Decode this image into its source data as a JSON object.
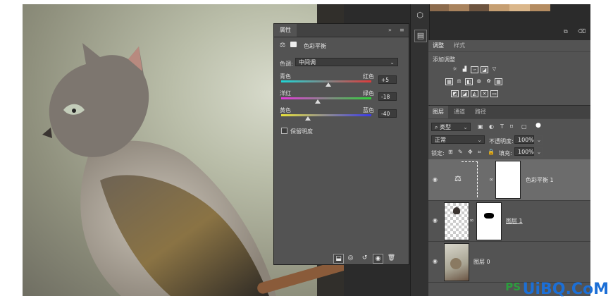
{
  "properties_panel": {
    "tab_label": "属性",
    "collapse_label": "»",
    "menu_label": "≡",
    "adjustment_name": "色彩平衡",
    "tone_label": "色调:",
    "tone_value": "中间调",
    "sliders": [
      {
        "left": "青色",
        "right": "红色",
        "value": "+5",
        "level": 0.525
      },
      {
        "left": "洋红",
        "right": "绿色",
        "value": "-18",
        "level": 0.41
      },
      {
        "left": "黄色",
        "right": "蓝色",
        "value": "-40",
        "level": 0.3
      }
    ],
    "preserve_luminosity_label": "保留明度"
  },
  "adjustments_panel": {
    "tab_adjust": "调整",
    "tab_styles": "样式",
    "add_adjustment_label": "添加调整"
  },
  "layers_panel": {
    "tab_layers": "图层",
    "tab_channels": "通道",
    "tab_paths": "路径",
    "filter_kind": "类型",
    "blend_mode": "正常",
    "opacity_label": "不透明度:",
    "opacity_value": "100%",
    "lock_label": "锁定:",
    "fill_label": "填充:",
    "fill_value": "100%",
    "layers": [
      {
        "name": "色彩平衡 1",
        "type": "adjustment"
      },
      {
        "name": "图层 1",
        "type": "masked-layer"
      },
      {
        "name": "图层 0",
        "type": "photo"
      }
    ]
  },
  "watermark": {
    "brand": "PS",
    "domain": "UiBQ.CoM"
  }
}
